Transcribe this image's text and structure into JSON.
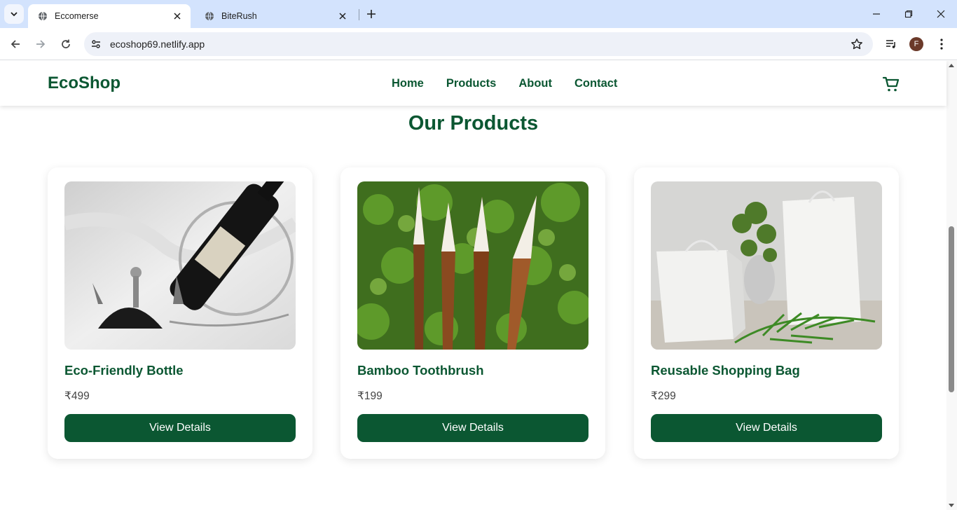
{
  "browser": {
    "tabs": [
      {
        "title": "Eccomerse",
        "active": true
      },
      {
        "title": "BiteRush",
        "active": false
      }
    ],
    "url": "ecoshop69.netlify.app",
    "profile_initial": "F"
  },
  "site": {
    "logo": "EcoShop",
    "nav": [
      "Home",
      "Products",
      "About",
      "Contact"
    ],
    "section_title": "Our Products",
    "brand_color": "#0b5732",
    "products": [
      {
        "name": "Eco-Friendly Bottle",
        "price": "₹499",
        "button": "View Details",
        "image": "wine-bottle-holder-photo"
      },
      {
        "name": "Bamboo Toothbrush",
        "price": "₹199",
        "button": "View Details",
        "image": "bamboo-brushes-photo"
      },
      {
        "name": "Reusable Shopping Bag",
        "price": "₹299",
        "button": "View Details",
        "image": "paper-bags-photo"
      }
    ]
  },
  "icons": [
    "chevron-down-icon",
    "globe-icon",
    "close-icon",
    "plus-icon",
    "minimize-icon",
    "restore-icon",
    "back-icon",
    "forward-icon",
    "reload-icon",
    "site-settings-icon",
    "star-icon",
    "media-icon",
    "menu-icon",
    "cart-icon"
  ]
}
